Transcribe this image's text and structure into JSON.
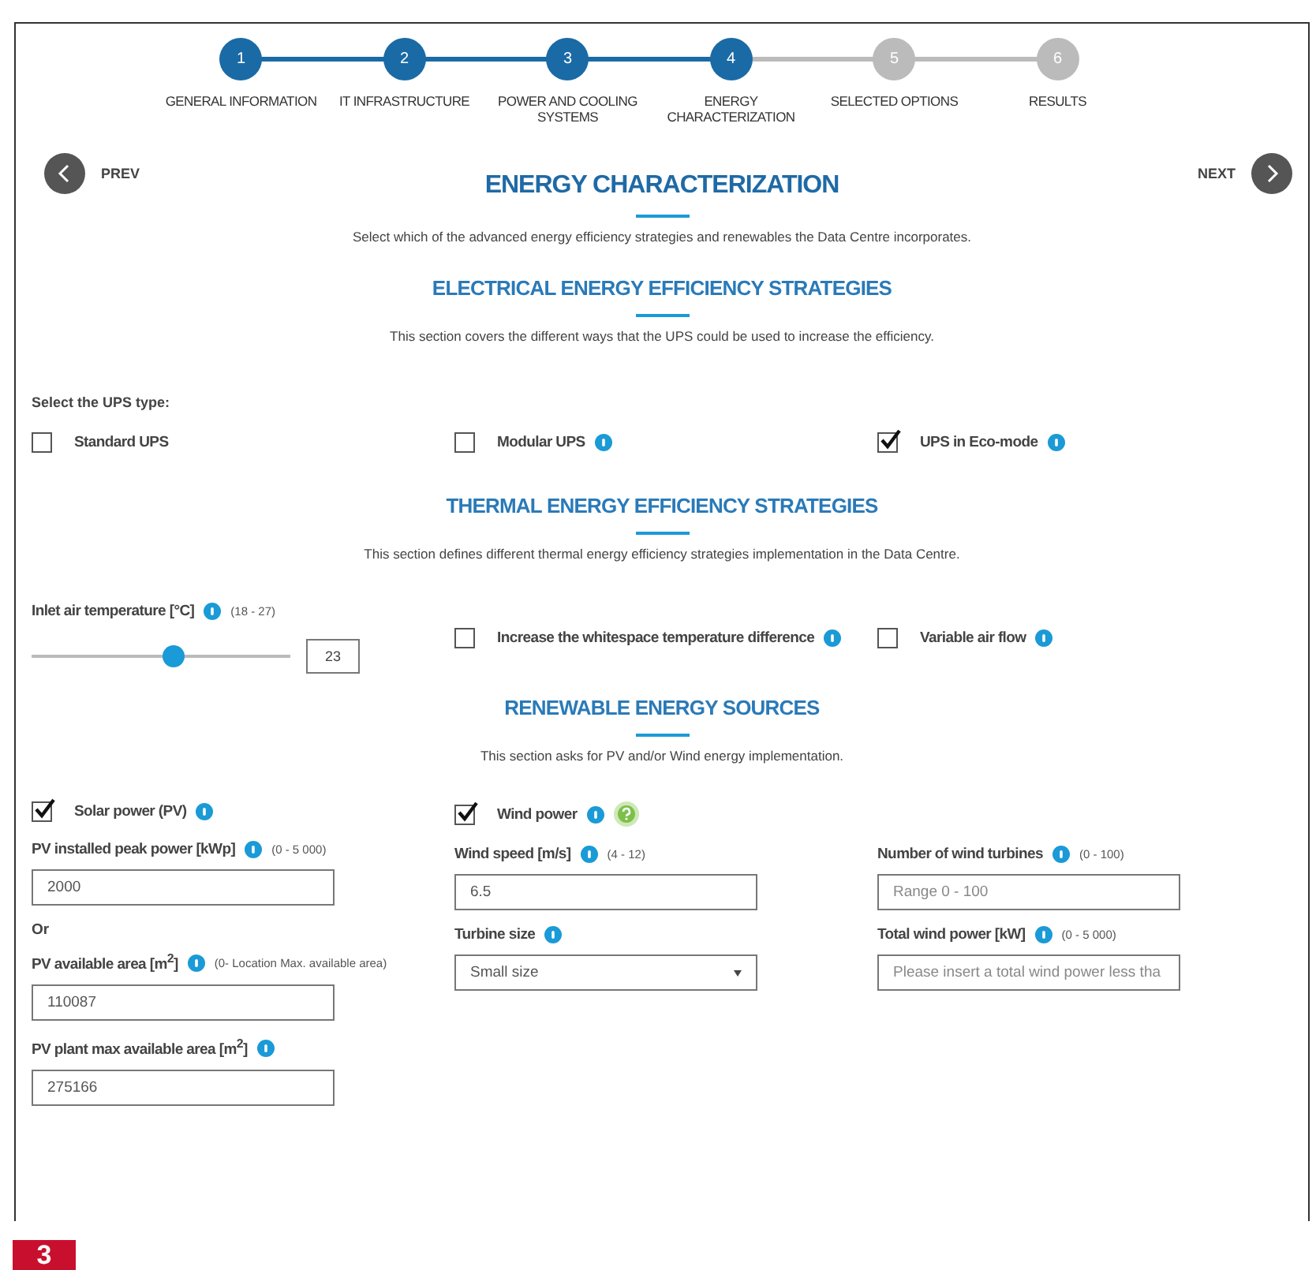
{
  "steps": [
    {
      "number": "1",
      "label": "GENERAL INFORMATION",
      "completed": true
    },
    {
      "number": "2",
      "label": "IT INFRASTRUCTURE",
      "completed": true
    },
    {
      "number": "3",
      "label": "POWER AND COOLING SYSTEMS",
      "completed": true
    },
    {
      "number": "4",
      "label": "ENERGY CHARACTERIZATION",
      "completed": true
    },
    {
      "number": "5",
      "label": "SELECTED OPTIONS",
      "completed": false
    },
    {
      "number": "6",
      "label": "RESULTS",
      "completed": false
    }
  ],
  "nav": {
    "prev": "PREV",
    "next": "NEXT"
  },
  "title": "ENERGY CHARACTERIZATION",
  "subtitle": "Select which of the advanced energy efficiency strategies and renewables the Data Centre incorporates.",
  "electrical": {
    "title": "ELECTRICAL ENERGY EFFICIENCY STRATEGIES",
    "description": "This section covers the different ways that the UPS could be used to increase the efficiency.",
    "prompt": "Select the UPS type:",
    "options": [
      {
        "label": "Standard UPS",
        "info": false,
        "checked": false
      },
      {
        "label": "Modular UPS",
        "info": true,
        "checked": false
      },
      {
        "label": "UPS in Eco-mode",
        "info": true,
        "checked": true
      }
    ]
  },
  "thermal": {
    "title": "THERMAL ENERGY EFFICIENCY STRATEGIES",
    "description": "This section defines different thermal energy efficiency strategies implementation in the Data Centre.",
    "temperature": {
      "label": "Inlet air temperature [°C]",
      "range": "(18 - 27)",
      "level": 0.55,
      "value": "23"
    },
    "options": [
      {
        "label": "Increase the whitespace temperature difference",
        "info": true,
        "checked": false
      },
      {
        "label": "Variable air flow",
        "info": true,
        "checked": false
      }
    ]
  },
  "renewable": {
    "title": "RENEWABLE ENERGY SOURCES",
    "description": "This section asks for PV and/or Wind energy implementation.",
    "columns": [
      {
        "toggle": {
          "label": "Solar power (PV)",
          "checked": true,
          "info": true,
          "help": false
        },
        "items": [
          {
            "kind": "field",
            "label": "PV installed peak power [kWp]",
            "range": "(0 - 5 000)",
            "value": "2000"
          },
          {
            "kind": "note",
            "text": "Or"
          },
          {
            "kind": "field",
            "label": "PV available area [m$^{2}$]",
            "range": "(0- Location Max. available area)",
            "value": "110087"
          },
          {
            "kind": "field",
            "label": "PV plant max available area [m$^{2}$]",
            "value": "275166"
          }
        ]
      },
      {
        "toggle": {
          "label": "Wind power",
          "checked": true,
          "info": true,
          "help": true
        },
        "items": [
          {
            "kind": "field",
            "label": "Wind speed [m/s]",
            "range": "(4 - 12)",
            "value": "6.5"
          },
          {
            "kind": "select",
            "label": "Turbine size",
            "value": "Small size"
          }
        ]
      },
      {
        "items": [
          {
            "kind": "field",
            "label": "Number of wind turbines",
            "range": "(0 - 100)",
            "placeholder": "Range 0 - 100"
          },
          {
            "kind": "field",
            "label": "Total wind power [kW]",
            "range": "(0 - 5 000)",
            "placeholder": "Please insert a total wind power less tha"
          }
        ]
      }
    ]
  },
  "figure_number": "3"
}
